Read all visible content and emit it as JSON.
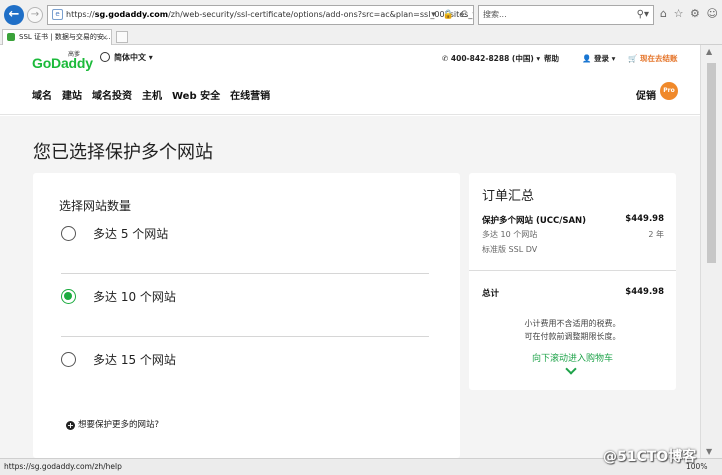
{
  "browser": {
    "url_prefix": "https://",
    "url_host": "sg.godaddy.com",
    "url_path": "/zh/web-security/ssl-certificate/options/add-ons?src=ac&plan=ssl_005sites_tier1_024mo",
    "search_placeholder": "搜索...",
    "tab_title": "SSL 证书 | 数据与交易的安...",
    "status_url": "https://sg.godaddy.com/zh/help",
    "zoom": "100%"
  },
  "header": {
    "logo": "GoDaddy",
    "logo_cn": "高爹",
    "language": "简体中文 ▾",
    "phone": "400-842-8288 (中国) ▾",
    "help": "帮助",
    "login": "登录 ▾",
    "cart": "现在去结账",
    "nav": [
      "域名",
      "建站",
      "域名投资",
      "主机",
      "Web 安全",
      "在线营销"
    ],
    "promo": "促销",
    "promo_badge": "Pro"
  },
  "page": {
    "title": "您已选择保护多个网站"
  },
  "options": {
    "heading": "选择网站数量",
    "items": [
      {
        "label": "多达 5 个网站",
        "selected": false
      },
      {
        "label": "多达 10 个网站",
        "selected": true
      },
      {
        "label": "多达 15 个网站",
        "selected": false
      }
    ],
    "more_link": "想要保护更多的网站?"
  },
  "summary": {
    "title": "订单汇总",
    "product": "保护多个网站 (UCC/SAN)",
    "product_price": "$449.98",
    "sites": "多达 10 个网站",
    "term": "2 年",
    "type": "标准版 SSL DV",
    "total_label": "总计",
    "total_price": "$449.98",
    "tax_note_1": "小计费用不含适用的税费。",
    "tax_note_2": "可在付款前调整期限长度。",
    "scroll_link": "向下滚动进入购物车"
  },
  "watermark": "@51CTO博客",
  "colors": {
    "brand_green": "#1bba3a",
    "cart_orange": "#e5752a",
    "link_green": "#1fa34a"
  }
}
